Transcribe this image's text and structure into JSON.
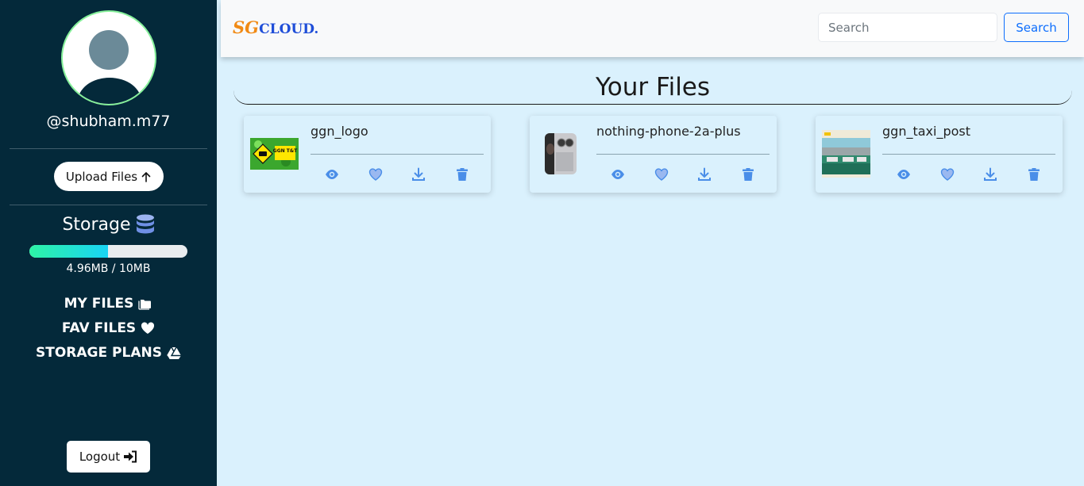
{
  "colors": {
    "sidebar_bg": "#04293a",
    "main_bg": "#daf1fd",
    "accent_blue": "#0d6efd",
    "brand_orange": "#f18a14",
    "brand_blue": "#1f4ed8",
    "storage_fill_start": "#2ef3a5",
    "storage_fill_end": "#19d4f5",
    "action_icon": "#4a8ee8"
  },
  "sidebar": {
    "username": "@shubham.m77",
    "upload_label": "Upload Files",
    "upload_icon": "arrow-up-icon",
    "storage_title": "Storage",
    "storage_icon": "database-icon",
    "storage_used_fraction": 0.496,
    "storage_text": "4.96MB / 10MB",
    "nav": [
      {
        "label": "MY FILES",
        "icon": "folder-icon"
      },
      {
        "label": "FAV FILES",
        "icon": "heart-icon"
      },
      {
        "label": "STORAGE PLANS",
        "icon": "google-drive-icon"
      }
    ],
    "logout_label": "Logout",
    "logout_icon": "sign-in-arrow-icon"
  },
  "header": {
    "brand_sg": "SG",
    "brand_cloud": "CLOUD.",
    "search_placeholder": "Search",
    "search_button": "Search"
  },
  "main": {
    "title": "Your Files",
    "files": [
      {
        "name": "ggn_logo",
        "thumb_text": "GGN T&T"
      },
      {
        "name": "nothing-phone-2a-plus"
      },
      {
        "name": "ggn_taxi_post"
      }
    ],
    "action_icons": [
      "eye-icon",
      "heart-icon",
      "download-icon",
      "trash-icon"
    ]
  }
}
